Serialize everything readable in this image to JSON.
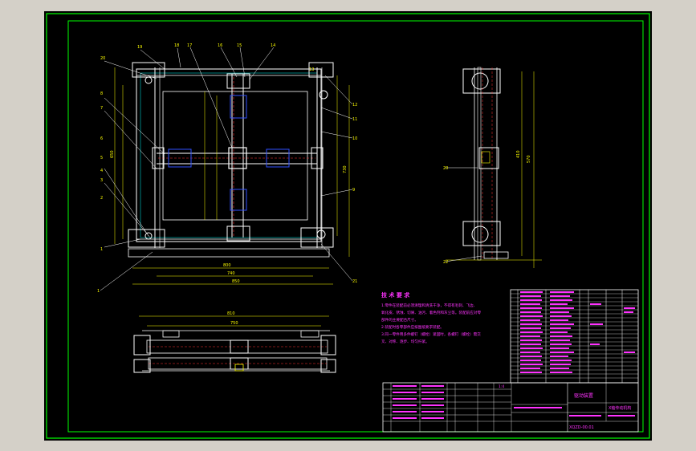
{
  "drawing": {
    "title_cn": "驱动装置",
    "part_name": "X轴传动机构",
    "drawing_no": "XQZD-00.01",
    "scale_note": "1:4"
  },
  "tech_requirements": {
    "heading": "技 术 要 求",
    "lines": [
      "1.零件在装配前必须清理和清洗干净，不得有毛刺、飞边、",
      "氧化皮、锈蚀、切屑、油污、着色剂和灰尘等。装配前应对零",
      "部件的主要配合尺寸。",
      "2.装配时各零部件应按图纸要求装配。",
      "3.同一零件用多件螺钉（螺栓）紧固时，各螺钉（螺栓）需交",
      "叉、对称、逐步、均匀拧紧。"
    ]
  },
  "dimensions": {
    "front_bottom_1": "800",
    "front_bottom_2": "740",
    "front_bottom_3": "850",
    "front_left": "650",
    "front_right": "730",
    "side_1": "570",
    "side_2": "410",
    "top_1": "810",
    "top_2": "750"
  },
  "balloons": [
    "1",
    "2",
    "3",
    "4",
    "5",
    "6",
    "7",
    "8",
    "9",
    "10",
    "11",
    "12",
    "13",
    "14",
    "15",
    "16",
    "17",
    "18",
    "19",
    "20",
    "21",
    "22"
  ],
  "colors": {
    "background": "#000000",
    "frame": "#00ff00",
    "lines": "#ffffff",
    "dims": "#ffff00",
    "hidden": "#ff3030",
    "annotation": "#ff33ff",
    "blue": "#3050ff",
    "cyan": "#00d0d0"
  }
}
